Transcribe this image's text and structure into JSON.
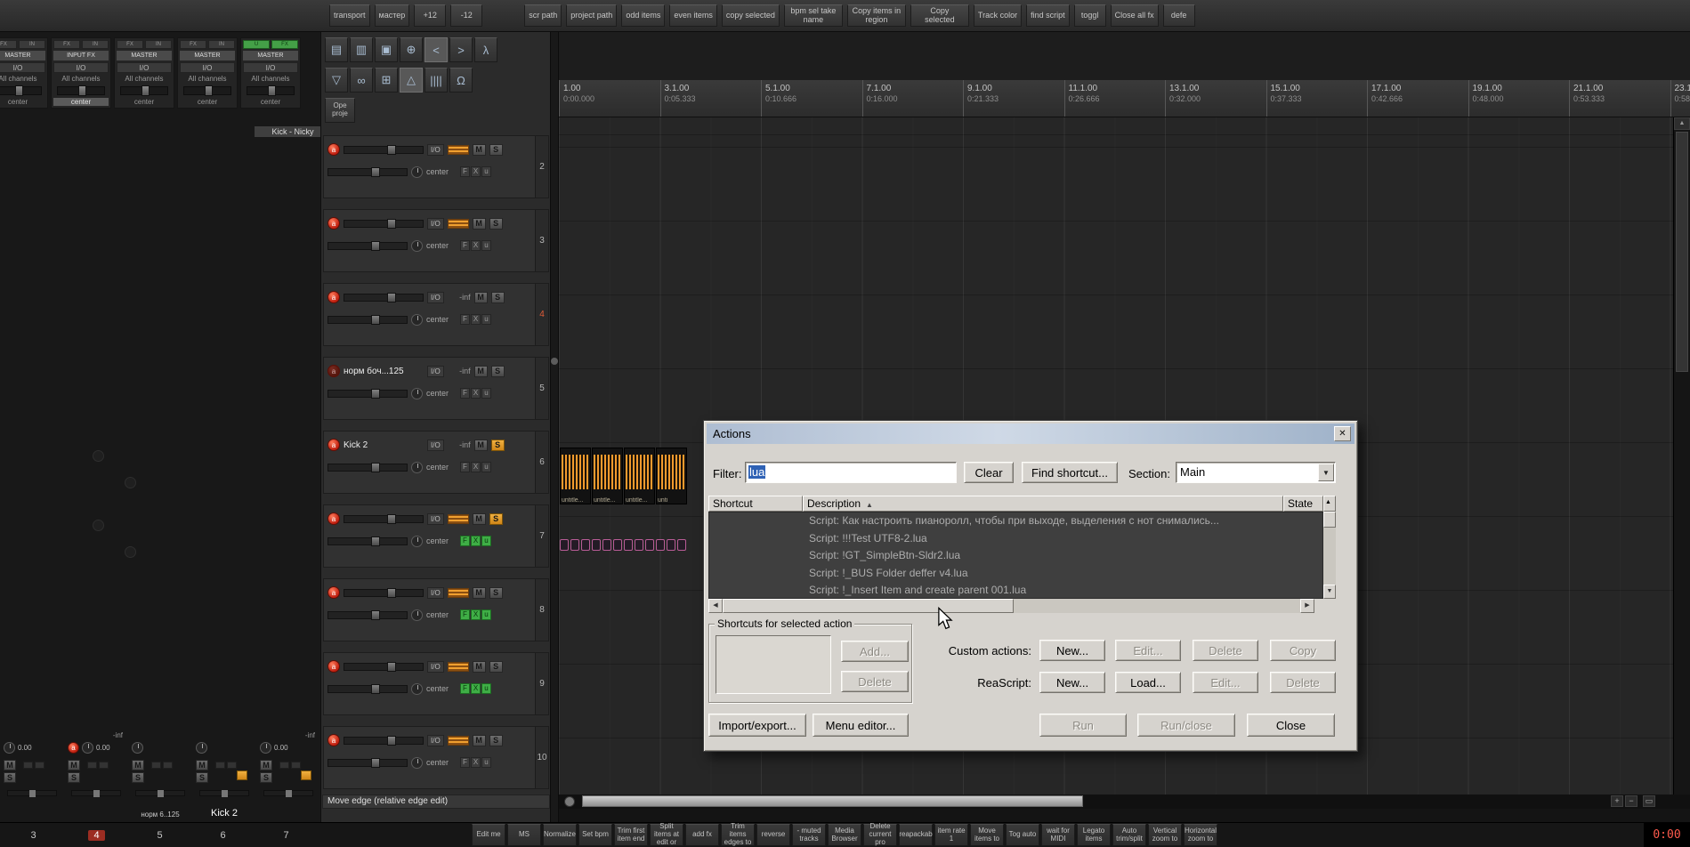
{
  "icons": {
    "close": "✕",
    "sort_asc": "▲",
    "combo_arrow": "▼",
    "scroll_up": "▲",
    "scroll_down": "▼",
    "scroll_left": "◀",
    "scroll_right": "▶",
    "zoom_in": "+",
    "zoom_out": "−",
    "zoom_fit": "▭"
  },
  "colors": {
    "accent_orange": "#f0a030",
    "record_red": "#c01f10",
    "fx_green": "#3fae46",
    "selection_blue": "#2f62b5",
    "time_red": "#ff5b4d"
  },
  "top_toolbar": {
    "buttons": [
      {
        "label": "transport"
      },
      {
        "label": "мастер"
      },
      {
        "label": "+12"
      },
      {
        "label": "-12",
        "cls": "gap-after"
      },
      {
        "label": "scr path"
      },
      {
        "label": "project path"
      },
      {
        "label": "odd items"
      },
      {
        "label": "even items"
      },
      {
        "label": "copy selected"
      },
      {
        "label": "bpm sel take name"
      },
      {
        "label": "Copy items in region"
      },
      {
        "label": "Copy selected"
      },
      {
        "label": "Track color"
      },
      {
        "label": "find script"
      },
      {
        "label": "toggl"
      },
      {
        "label": "Close all fx"
      },
      {
        "label": "defe"
      }
    ]
  },
  "tool_icons": {
    "row1": [
      {
        "glyph": "▤",
        "name": "new-project-icon"
      },
      {
        "glyph": "▥",
        "name": "open-project-icon"
      },
      {
        "glyph": "▣",
        "name": "save-project-icon"
      },
      {
        "glyph": "⊕",
        "name": "attach-icon"
      },
      {
        "glyph": "<",
        "name": "undo-icon",
        "cls": "active"
      },
      {
        "glyph": ">",
        "name": "redo-icon"
      },
      {
        "glyph": "λ",
        "name": "actions-icon"
      }
    ],
    "row2": [
      {
        "glyph": "▽",
        "name": "filter-tool-icon"
      },
      {
        "glyph": "∞",
        "name": "link-tool-icon"
      },
      {
        "glyph": "⊞",
        "name": "grid-tool-icon"
      },
      {
        "glyph": "△",
        "name": "envelope-tool-icon",
        "cls": "active"
      },
      {
        "glyph": "||||",
        "name": "stretch-tool-icon"
      },
      {
        "glyph": "Ω",
        "name": "mute-tool-icon"
      }
    ],
    "ope_button": "Ope proje"
  },
  "mixer_top": {
    "strips": [
      {
        "b1": "FX",
        "b2": "IN",
        "badge": "MASTER",
        "io": "I/O",
        "channels": "All channels",
        "pan": "center",
        "cls": "clip-left"
      },
      {
        "b1": "FX",
        "b2": "IN",
        "badge": "INPUT FX",
        "io": "I/O",
        "channels": "All channels",
        "pan": "center",
        "cls": "sel-pan"
      },
      {
        "b1": "FX",
        "b2": "IN",
        "badge": "MASTER",
        "io": "I/O",
        "channels": "All channels",
        "pan": "center"
      },
      {
        "b1": "FX",
        "b2": "IN",
        "badge": "MASTER",
        "io": "I/O",
        "channels": "All channels",
        "pan": "center"
      },
      {
        "b1": "U",
        "b2": "FX",
        "badge": "MASTER",
        "io": "I/O",
        "channels": "All channels",
        "pan": "center",
        "cls": "green-btns"
      }
    ],
    "track_name": "Kick - Nicky"
  },
  "tcp": {
    "labels": {
      "arm": "a",
      "io": "I/O",
      "m": "M",
      "s": "S",
      "pan": "center",
      "f": "F",
      "x": "X",
      "u": "u"
    },
    "tracks": [
      {
        "num": "2",
        "vol_badge": true
      },
      {
        "num": "3",
        "vol_badge": true
      },
      {
        "num": "4",
        "vol": "-inf",
        "cls": "num-sel"
      },
      {
        "num": "5",
        "name": "норм боч...125",
        "vol": "-inf",
        "cls": "has-name arm-dim"
      },
      {
        "num": "6",
        "name": "Kick 2",
        "vol": "-inf",
        "cls": "has-name s-on"
      },
      {
        "num": "7",
        "vol_badge": true,
        "cls": "s-on fx-green"
      },
      {
        "num": "8",
        "vol_badge": true,
        "cls": "fx-green"
      },
      {
        "num": "9",
        "vol_badge": true,
        "cls": "fx-green"
      },
      {
        "num": "10",
        "vol_badge": true
      }
    ]
  },
  "ruler": {
    "ticks": [
      {
        "bar": "1.00",
        "time": "0:00.000"
      },
      {
        "bar": "3.1.00",
        "time": "0:05.333"
      },
      {
        "bar": "5.1.00",
        "time": "0:10.666"
      },
      {
        "bar": "7.1.00",
        "time": "0:16.000"
      },
      {
        "bar": "9.1.00",
        "time": "0:21.333"
      },
      {
        "bar": "11.1.00",
        "time": "0:26.666"
      },
      {
        "bar": "13.1.00",
        "time": "0:32.000"
      },
      {
        "bar": "15.1.00",
        "time": "0:37.333"
      },
      {
        "bar": "17.1.00",
        "time": "0:42.666"
      },
      {
        "bar": "19.1.00",
        "time": "0:48.000"
      },
      {
        "bar": "21.1.00",
        "time": "0:53.333"
      },
      {
        "bar": "23.1.00",
        "time": "0:58.666"
      }
    ]
  },
  "arrange": {
    "clip_labels": [
      "untitle...",
      "untitle...",
      "untitle...",
      "unti"
    ]
  },
  "actions_dialog": {
    "title": "Actions",
    "filter_label": "Filter:",
    "filter_value": "lua",
    "clear_button": "Clear",
    "find_shortcut_button": "Find shortcut...",
    "section_label": "Section:",
    "section_value": "Main",
    "col_shortcut": "Shortcut",
    "col_description": "Description",
    "col_state": "State",
    "rows": [
      "Script: Как настроить пианоролл, чтобы при выходе, выделения с нот снимались...",
      "Script: !!!Test UTF8-2.lua",
      "Script: !GT_SimpleBtn-Sldr2.lua",
      "Script: !_BUS Folder deffer v4.lua",
      "Script: !_Insert Item and create parent 001.lua"
    ],
    "shortcuts_group_title": "Shortcuts for selected action",
    "add_button": "Add...",
    "delete_button": "Delete",
    "custom_actions_label": "Custom actions:",
    "reascript_label": "ReaScript:",
    "new_button": "New...",
    "edit_button": "Edit...",
    "copy_button": "Copy",
    "load_button": "Load...",
    "import_export_button": "Import/export...",
    "menu_editor_button": "Menu editor...",
    "run_button": "Run",
    "run_close_button": "Run/close",
    "close_button": "Close"
  },
  "status_bar": {
    "text": "Move edge (relative edge edit)"
  },
  "bottom_toolbar": {
    "buttons": [
      "Edit me",
      "MS",
      "Normalize",
      "Set bpm",
      "Trim first item end",
      "Split items at edit or",
      "add fx",
      "Trim items edges to",
      "reverse",
      "- muted tracks",
      "Media Browser",
      "Delete current pro",
      "reapackab",
      "item rate 1",
      "Move items to",
      "Tog auto",
      "wait for MIDI",
      "Legato items",
      "Auto trim/split",
      "Vertical zoom to",
      "Horizontal zoom to"
    ]
  },
  "mixer_bottom": {
    "strips": [
      {
        "value": "0.00"
      },
      {
        "value": "0.00",
        "inf": "-inf",
        "arm": true
      },
      {
        "name": "норм 6..125"
      },
      {
        "name": "Kick 2",
        "chip": true,
        "cls": "big-name"
      },
      {
        "value": "0.00",
        "inf": "-inf",
        "chip": true
      }
    ],
    "nums": [
      {
        "n": "3"
      },
      {
        "n": "4",
        "cls": "sel"
      },
      {
        "n": "5"
      },
      {
        "n": "6"
      },
      {
        "n": "7"
      }
    ]
  },
  "transport": {
    "time_display": "0:00"
  }
}
